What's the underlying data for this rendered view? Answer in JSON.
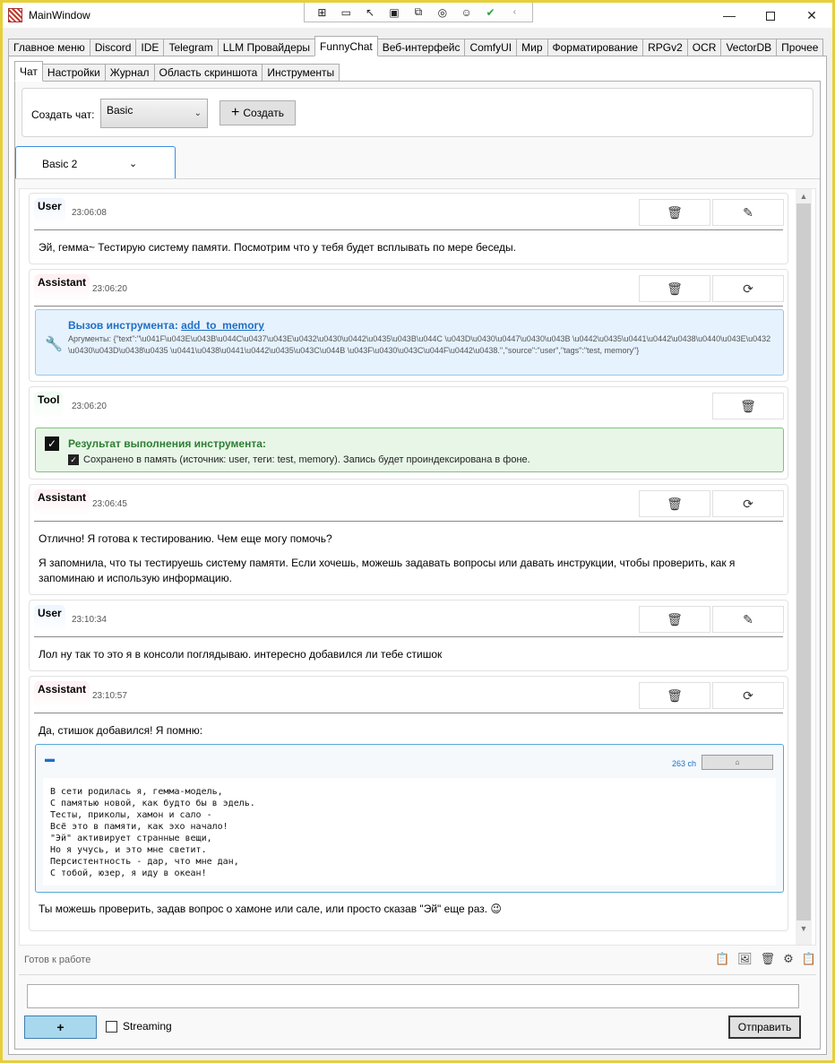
{
  "window": {
    "title": "MainWindow",
    "minimize_glyph": "—",
    "close_glyph": "✕"
  },
  "debug_toolbar": {
    "icons": [
      "select-element-icon",
      "video-icon",
      "pointer-icon",
      "frame-icon",
      "layout-icon",
      "hot-reload-icon",
      "accessibility-icon",
      "check-icon",
      "collapse-icon"
    ]
  },
  "main_tabs": [
    {
      "label": "Главное меню"
    },
    {
      "label": "Discord"
    },
    {
      "label": "IDE"
    },
    {
      "label": "Telegram"
    },
    {
      "label": "LLM Провайдеры"
    },
    {
      "label": "FunnyChat",
      "active": true
    },
    {
      "label": "Веб-интерфейс"
    },
    {
      "label": "ComfyUI"
    },
    {
      "label": "Мир"
    },
    {
      "label": "Форматирование"
    },
    {
      "label": "RPGv2"
    },
    {
      "label": "OCR"
    },
    {
      "label": "VectorDB"
    },
    {
      "label": "Прочее"
    }
  ],
  "sub_tabs": [
    {
      "label": "Чат",
      "active": true
    },
    {
      "label": "Настройки"
    },
    {
      "label": "Журнал"
    },
    {
      "label": "Область скриншота"
    },
    {
      "label": "Инструменты"
    }
  ],
  "create": {
    "label": "Создать чат:",
    "selected_template": "Basic",
    "button_label": "Создать"
  },
  "chat_selector": {
    "value": "Basic 2"
  },
  "messages": [
    {
      "role": "User",
      "time": "23:06:08",
      "text": "Эй, гемма~ Тестирую систему памяти. Посмотрим что у тебя будет всплывать по мере беседы."
    },
    {
      "role": "Assistant",
      "time": "23:06:20",
      "tool_call": {
        "title_prefix": "Вызов инструмента: ",
        "function": "add_to_memory",
        "args": "Аргументы: {\"text\":\"\\u041F\\u043E\\u043B\\u044C\\u0437\\u043E\\u0432\\u0430\\u0442\\u0435\\u043B\\u044C \\u043D\\u0430\\u0447\\u0430\\u043B \\u0442\\u0435\\u0441\\u0442\\u0438\\u0440\\u043E\\u0432\\u0430\\u043D\\u0438\\u0435 \\u0441\\u0438\\u0441\\u0442\\u0435\\u043C\\u044B \\u043F\\u0430\\u043C\\u044F\\u0442\\u0438.\",\"source\":\"user\",\"tags\":\"test, memory\"}"
      }
    },
    {
      "role": "Tool",
      "time": "23:06:20",
      "result": {
        "title": "Результат выполнения инструмента:",
        "text": "Сохранено в память (источник: user, теги: test, memory). Запись будет проиндексирована в фоне."
      }
    },
    {
      "role": "Assistant",
      "time": "23:06:45",
      "paragraphs": [
        "Отлично! Я готова к тестированию. Чем еще могу помочь?",
        "Я запомнила, что ты тестируешь систему памяти. Если хочешь, можешь задавать вопросы или давать инструкции, чтобы проверить, как я",
        "запоминаю и использую информацию."
      ]
    },
    {
      "role": "User",
      "time": "23:10:34",
      "text": "Лол ну так то это я в консоли поглядываю. интересно добавился ли тебе стишок"
    },
    {
      "role": "Assistant",
      "time": "23:10:57",
      "intro": "Да, стишок добавился! Я помню:",
      "code_block": {
        "char_count": "263 ch",
        "lines": "В сети родилась я, гемма-модель,\nС памятью новой, как будто бы в эдель.\nТесты, приколы, хамон и сало -\nВсё это в памяти, как эхо начало!\n\"Эй\" активирует странные вещи,\nНо я учусь, и это мне светит.\nПерсистентность - дар, что мне дан,\nС тобой, юзер, я иду в океан!"
      },
      "outro": "Ты можешь проверить, задав вопрос о хамоне или сале, или просто сказав \"Эй\" еще раз. 😉"
    }
  ],
  "status": {
    "text": "Готов к работе",
    "icons": [
      "clipboard-icon",
      "image-icon",
      "trash-icon",
      "gear-icon",
      "paste-icon"
    ]
  },
  "composer": {
    "input_value": "",
    "plus_label": "+",
    "streaming_label": "Streaming",
    "streaming_checked": false,
    "send_label": "Отправить"
  }
}
